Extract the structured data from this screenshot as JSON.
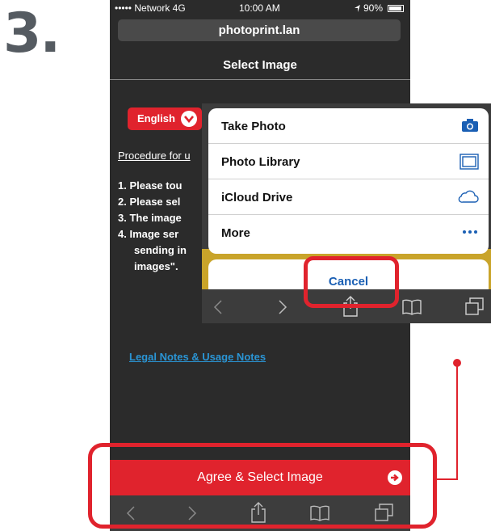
{
  "step": {
    "number": "3."
  },
  "status_bar": {
    "carrier": "••••• Network 4G",
    "time": "10:00 AM",
    "battery": "90%"
  },
  "browser": {
    "url": "photoprint.lan"
  },
  "page": {
    "title": "Select Image",
    "language_button": "English",
    "procedure_link": "Procedure for u",
    "steps": [
      "1.  Please tou",
      "2.  Please sel",
      "3.  The image",
      "4.  Image ser",
      "sending in",
      "images\"."
    ],
    "legal_link": "Legal Notes & Usage Notes",
    "agree_button": "Agree & Select Image"
  },
  "action_sheet": {
    "items": [
      {
        "label": "Take Photo",
        "icon": "camera-icon"
      },
      {
        "label": "Photo Library",
        "icon": "photo-library-icon"
      },
      {
        "label": "iCloud Drive",
        "icon": "cloud-icon"
      },
      {
        "label": "More",
        "icon": "more-icon"
      }
    ],
    "cancel": "Cancel"
  },
  "colors": {
    "accent": "#e0232d",
    "link": "#2a95d5",
    "ios_blue": "#1a5fb4"
  }
}
